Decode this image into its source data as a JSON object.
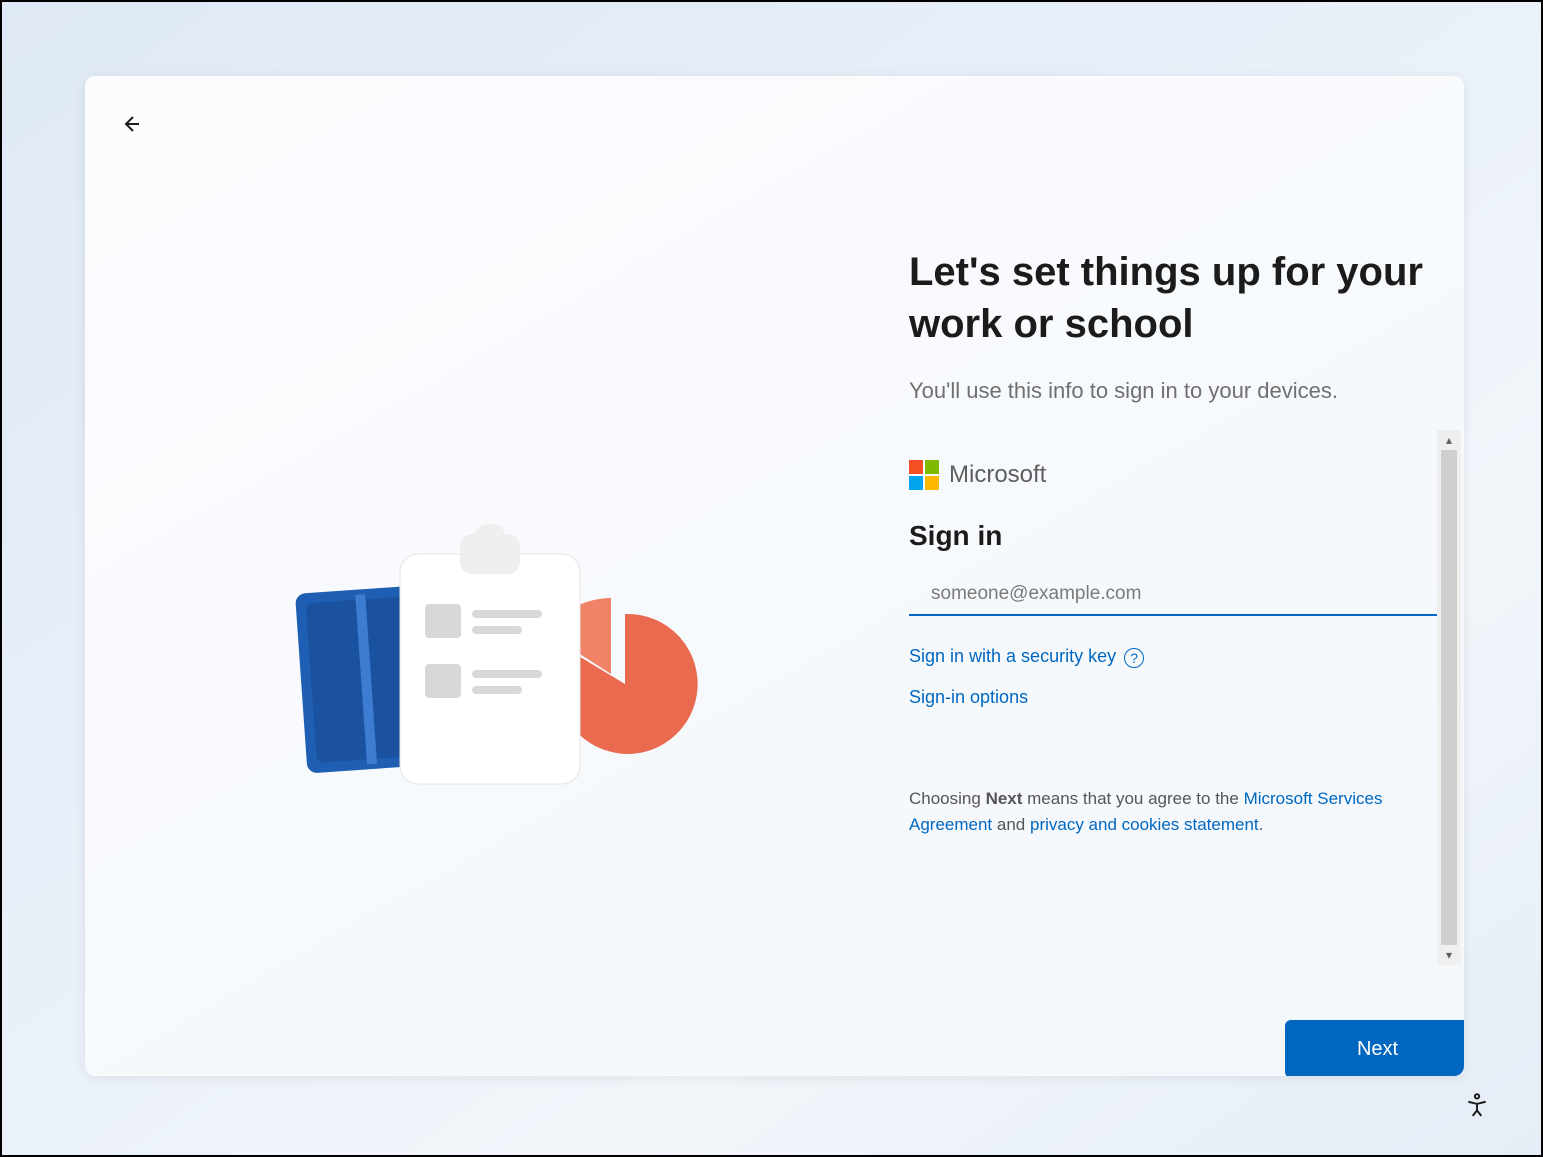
{
  "header": {
    "title": "Let's set things up for your work or school",
    "subtitle": "You'll use this info to sign in to your devices."
  },
  "brand": {
    "name": "Microsoft"
  },
  "signin": {
    "heading": "Sign in",
    "email_placeholder": "someone@example.com",
    "security_key_link": "Sign in with a security key",
    "options_link": "Sign-in options"
  },
  "agreement": {
    "prefix": "Choosing ",
    "strong": "Next",
    "mid": " means that you agree to the ",
    "link1": "Microsoft Services Agreement",
    "sep": " and ",
    "link2": "privacy and cookies statement",
    "suffix": "."
  },
  "footer": {
    "next_label": "Next"
  },
  "colors": {
    "accent": "#0067c0"
  }
}
